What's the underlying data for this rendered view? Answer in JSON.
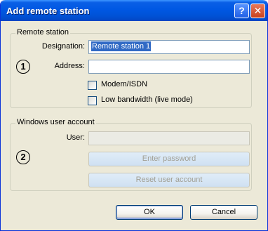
{
  "window": {
    "title": "Add remote station",
    "help_glyph": "?",
    "close_glyph": "✕"
  },
  "remote_station": {
    "legend": "Remote station",
    "marker": "1",
    "designation_label": "Designation:",
    "designation_value": "Remote station  1",
    "address_label": "Address:",
    "address_value": "",
    "modem_label": "Modem/ISDN",
    "modem_checked": false,
    "low_bandwidth_label": "Low bandwidth (live mode)",
    "low_bandwidth_checked": false
  },
  "windows_user_account": {
    "legend": "Windows user account",
    "marker": "2",
    "user_label": "User:",
    "user_value": "",
    "enter_password_label": "Enter password",
    "reset_user_account_label": "Reset user account"
  },
  "footer": {
    "ok_label": "OK",
    "cancel_label": "Cancel"
  }
}
